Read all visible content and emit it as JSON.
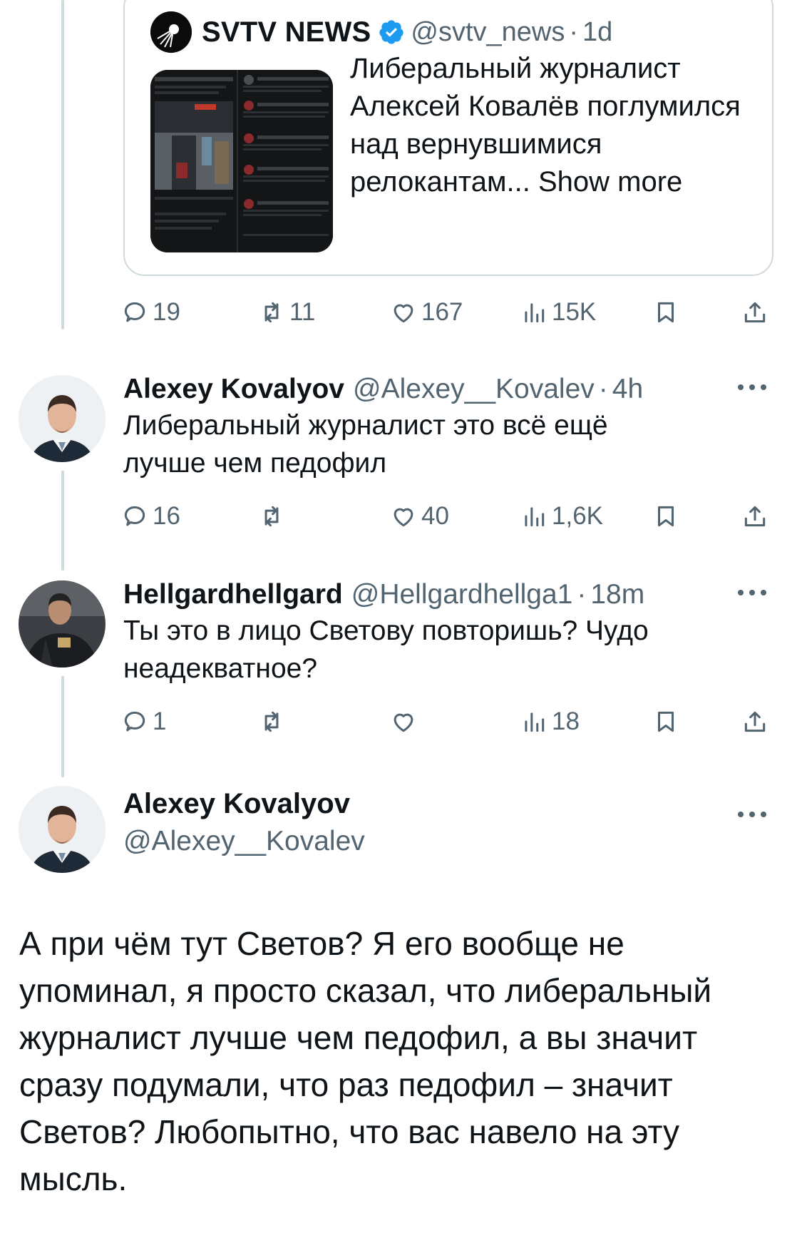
{
  "quoted_tweet": {
    "name": "SVTV NEWS",
    "handle": "@svtv_news",
    "time": "1d",
    "text": "Либеральный журналист Алексей Ковалёв поглумился над вернувшимися релокантам...",
    "show_more": "Show more",
    "stats": {
      "replies": "19",
      "retweets": "11",
      "likes": "167",
      "views": "15K"
    }
  },
  "reply_1": {
    "name": "Alexey Kovalyov",
    "handle": "@Alexey__Kovalev",
    "time": "4h",
    "text": "Либеральный журналист это всё ещё лучше чем педофил",
    "stats": {
      "replies": "16",
      "retweets": "",
      "likes": "40",
      "views": "1,6K"
    }
  },
  "reply_2": {
    "name": "Hellgardhellgard",
    "handle": "@Hellgardhellga1",
    "time": "18m",
    "text": "Ты это в лицо Светову повторишь? Чудо неадекватное?",
    "stats": {
      "replies": "1",
      "retweets": "",
      "likes": "",
      "views": "18"
    }
  },
  "main_tweet": {
    "name": "Alexey Kovalyov",
    "handle": "@Alexey__Kovalev",
    "text": "А при чём тут Светов? Я его вообще не упоминал, я просто сказал, что либеральный журналист лучше чем педофил, а вы значит сразу подумали, что раз педофил – значит Светов? Любопытно, что вас навело на эту мысль."
  },
  "separator": "·",
  "colors": {
    "text": "#0f1419",
    "secondary": "#536471",
    "border": "#cfd9de",
    "verified": "#1d9bf0"
  }
}
